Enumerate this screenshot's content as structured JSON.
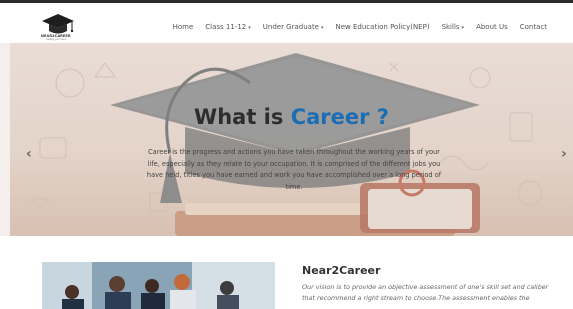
{
  "brand": {
    "logo_text": "NEAR2CAREER",
    "logo_tagline": "Guiding your future"
  },
  "nav": {
    "items": [
      {
        "label": "Home",
        "has_dropdown": false
      },
      {
        "label": "Class 11-12",
        "has_dropdown": true
      },
      {
        "label": "Under Graduate",
        "has_dropdown": true
      },
      {
        "label": "New Education Policy(NEP)",
        "has_dropdown": false
      },
      {
        "label": "Skills",
        "has_dropdown": true
      },
      {
        "label": "About Us",
        "has_dropdown": false
      },
      {
        "label": "Contact",
        "has_dropdown": false
      }
    ],
    "dropdown_icon": "chevron-down-icon"
  },
  "hero": {
    "title_prefix": "What is",
    "title_accent": "Career ?",
    "description": "Career is the progress and actions you have taken throughout the working years of your life, especially as they relate to your occupation. It is comprised of the different jobs you have held, titles you have earned and work you have accomplished over a long period of time.",
    "prev_arrow": "‹",
    "next_arrow": "›",
    "accent_color": "#1b6db4"
  },
  "about": {
    "title": "Near2Career",
    "text": "Our vision is to provide an objective assessment of one's skill set and caliber that recommend a right stream to choose.The assessment enables the"
  }
}
